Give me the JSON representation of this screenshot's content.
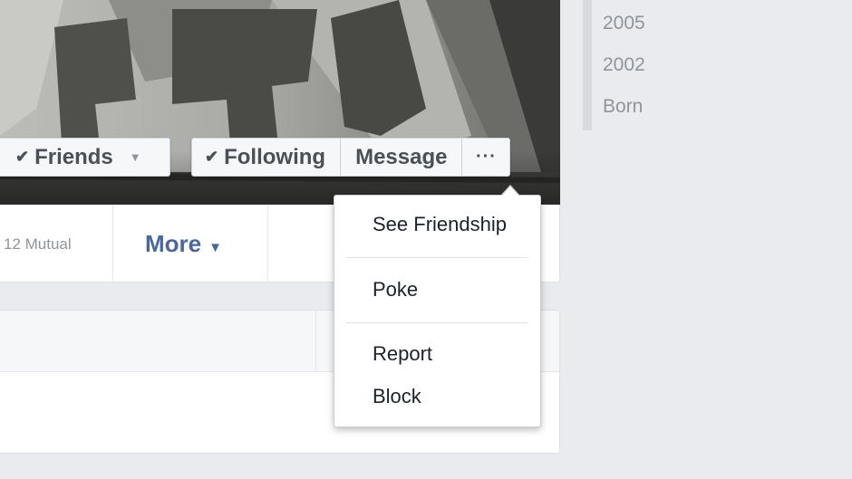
{
  "profile_actions": {
    "friends_label": "Friends",
    "following_label": "Following",
    "message_label": "Message",
    "more_label": "···"
  },
  "profile_nav": {
    "mutual_label": "12 Mutual",
    "more_label": "More"
  },
  "timeline": {
    "years": [
      "2005",
      "2002",
      "Born"
    ]
  },
  "dropdown_menu": {
    "items": [
      "See Friendship",
      "Poke",
      "Report",
      "Block"
    ]
  },
  "icons": {
    "check": "check-icon",
    "caret": "caret-down-icon"
  },
  "colors": {
    "page_background": "#e9ebee",
    "link_blue": "#4b67a1",
    "button_text": "#4b4f56",
    "muted_text": "#90949c"
  }
}
